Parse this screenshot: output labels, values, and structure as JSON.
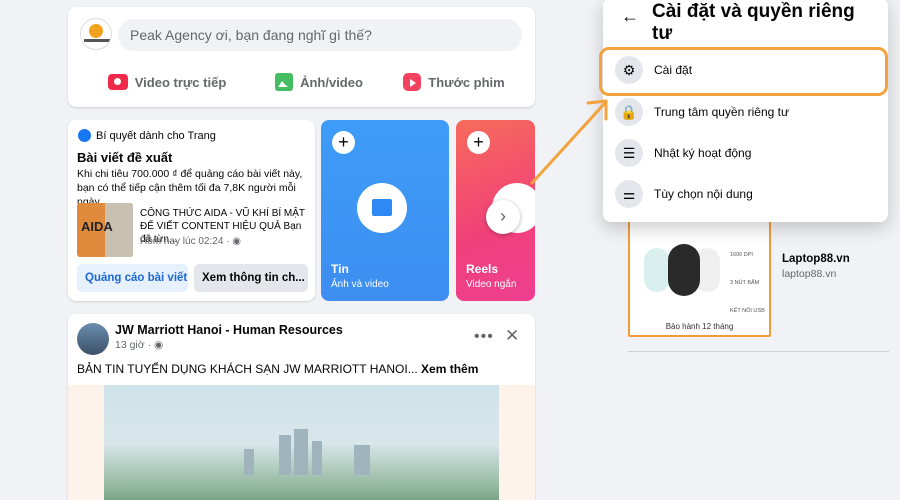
{
  "composer": {
    "placeholder": "Peak Agency ơi, bạn đang nghĩ gì thế?",
    "actions": [
      {
        "label": "Video trực tiếp",
        "icon": "live-video-icon",
        "color": "#f02849"
      },
      {
        "label": "Ảnh/video",
        "icon": "photo-icon",
        "color": "#45bd62"
      },
      {
        "label": "Thước phim",
        "icon": "reel-icon",
        "color": "#f3425f"
      }
    ]
  },
  "tips": {
    "header": "Bí quyết dành cho Trang",
    "title": "Bài viết đề xuất",
    "description": "Khi chi tiêu 700.000 ₫ để quảng cáo bài viết này, bạn có thể tiếp cận thêm tối đa 7,8K người mỗi ngày.",
    "thumb_text": "AIDA",
    "post_text": "CÔNG THỨC AIDA - VŨ KHÍ BÍ MẬT ĐỂ VIẾT CONTENT HIỆU QUẢ Bạn đã từn...",
    "post_time": "Hôm nay lúc 02:24 · ◉",
    "boost_button": "Quảng cáo bài viết",
    "insights_button": "Xem thông tin ch..."
  },
  "stories": [
    {
      "name": "Tin",
      "sub": "Ảnh và video",
      "color": "#3e9cf8"
    },
    {
      "name": "Reels",
      "sub": "Video ngắn",
      "color": "#f0407a"
    }
  ],
  "post": {
    "author": "JW Marriott Hanoi - Human Resources",
    "time": "13 giờ · ◉",
    "text": "BẢN TIN TUYỂN DỤNG KHÁCH SẠN JW MARRIOTT HANOI...",
    "see_more": "Xem thêm"
  },
  "sponsored": {
    "name": "Laptop88.vn",
    "url": "laptop88.vn",
    "warranty": "Bảo hành 12 tháng",
    "specs": [
      "1600 DPI",
      "3 NÚT BẤM",
      "KẾT NỐI USB"
    ]
  },
  "menu": {
    "title": "Cài đặt và quyền riêng tư",
    "items": [
      {
        "label": "Cài đặt",
        "icon": "gear-icon",
        "glyph": "⚙"
      },
      {
        "label": "Trung tâm quyền riêng tư",
        "icon": "lock-icon",
        "glyph": "🔒"
      },
      {
        "label": "Nhật ký hoạt động",
        "icon": "list-icon",
        "glyph": "☰"
      },
      {
        "label": "Tùy chọn nội dung",
        "icon": "sliders-icon",
        "glyph": "⚌"
      }
    ]
  },
  "colors": {
    "highlight": "#f4a23b",
    "accent": "#1877f2"
  }
}
